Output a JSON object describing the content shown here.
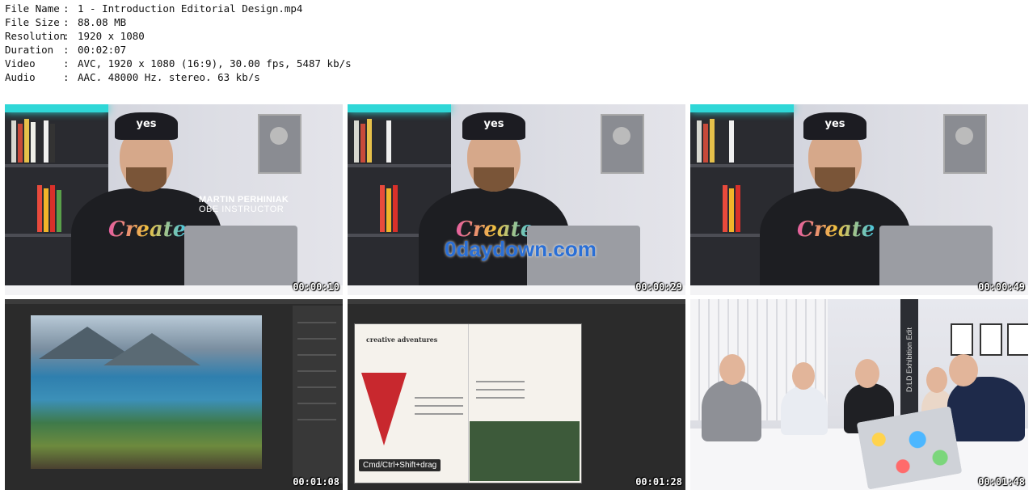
{
  "metadata": [
    {
      "key": "File Name",
      "value": "1 - Introduction Editorial Design.mp4"
    },
    {
      "key": "File Size",
      "value": "88.08 MB"
    },
    {
      "key": "Resolution",
      "value": "1920 x 1080"
    },
    {
      "key": "Duration",
      "value": "00:02:07"
    },
    {
      "key": "Video",
      "value": "AVC, 1920 x 1080 (16:9), 30.00 fps, 5487 kb/s"
    },
    {
      "key": "Audio",
      "value": "AAC, 48000 Hz, stereo, 63 kb/s"
    }
  ],
  "separator": ":",
  "thumbnails": [
    {
      "timestamp": "00:00:10",
      "lower_third_name": "MARTIN PERHINIAK",
      "lower_third_role": "OBE INSTRUCTOR",
      "cap_text": "yes"
    },
    {
      "timestamp": "00:00:29",
      "watermark": "0daydown.com",
      "cap_text": "yes"
    },
    {
      "timestamp": "00:00:49",
      "cap_text": "yes"
    },
    {
      "timestamp": "00:01:08"
    },
    {
      "timestamp": "00:01:28",
      "tooltip": "Cmd/Ctrl+Shift+drag",
      "magazine_title": "creative adventures"
    },
    {
      "timestamp": "00:01:48",
      "banner_text": "D:LD Exhibition Edit"
    }
  ],
  "shirt_text": "Create",
  "colors": {
    "neon": "#2fd7d7",
    "accent_red": "#c8282e",
    "watermark_blue": "#2a6fd6"
  }
}
